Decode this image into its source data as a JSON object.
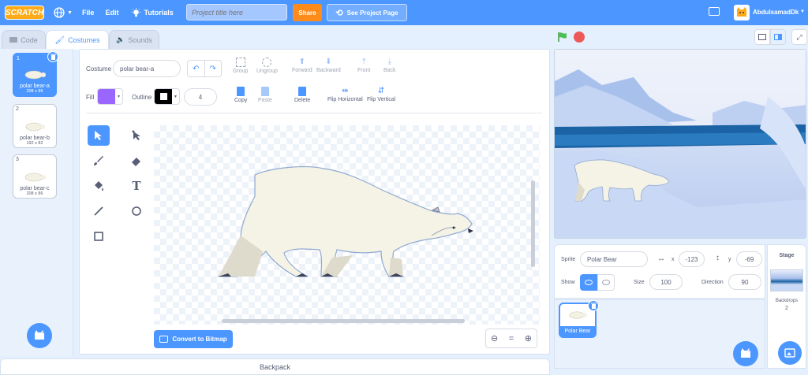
{
  "menubar": {
    "logo": "SCRATCH",
    "file": "File",
    "edit": "Edit",
    "tutorials": "Tutorials",
    "title_placeholder": "Project title here",
    "share": "Share",
    "see_project": "See Project Page",
    "username": "AbdulsamadDk"
  },
  "tabs": {
    "code": "Code",
    "costumes": "Costumes",
    "sounds": "Sounds"
  },
  "costumes": [
    {
      "index": "1",
      "name": "polar bear-a",
      "size": "208 x 86"
    },
    {
      "index": "2",
      "name": "polar bear-b",
      "size": "192 x 82"
    },
    {
      "index": "3",
      "name": "polar bear-c",
      "size": "208 x 86"
    }
  ],
  "editor": {
    "costume_label": "Costume",
    "costume_name": "polar bear-a",
    "group": "Group",
    "ungroup": "Ungroup",
    "forward": "Forward",
    "backward": "Backward",
    "front": "Front",
    "back": "Back",
    "fill_label": "Fill",
    "outline_label": "Outline",
    "outline_width": "4",
    "copy": "Copy",
    "paste": "Paste",
    "delete": "Delete",
    "flip_h": "Flip Horizontal",
    "flip_v": "Flip Vertical",
    "convert": "Convert to Bitmap",
    "fill_color": "#9966ff",
    "outline_color": "#000000"
  },
  "sprite": {
    "sprite_label": "Sprite",
    "name": "Polar Bear",
    "x_label": "x",
    "x": "-123",
    "y_label": "y",
    "y": "-69",
    "show_label": "Show",
    "size_label": "Size",
    "size": "100",
    "direction_label": "Direction",
    "direction": "90",
    "tile_name": "Polar Bear"
  },
  "stage_pane": {
    "title": "Stage",
    "backdrops_label": "Backdrops",
    "backdrops_count": "2"
  },
  "backpack": "Backpack",
  "colors": {
    "accent": "#4c97ff",
    "share": "#ff8c1a",
    "stop": "#ec5959",
    "flag": "#4cbf56"
  }
}
